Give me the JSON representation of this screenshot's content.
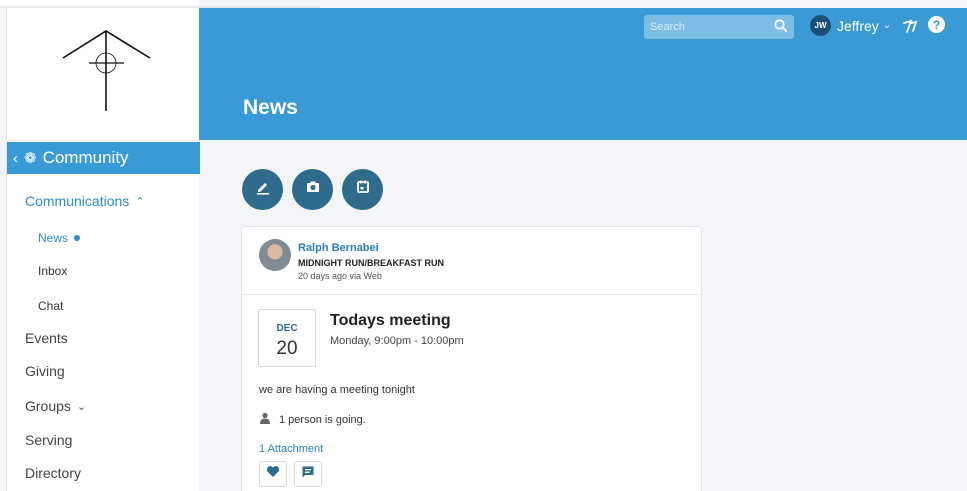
{
  "colors": {
    "accent": "#3a9ad5",
    "action_button": "#2f6b8c",
    "link": "#2c7fbb"
  },
  "sidebar": {
    "community_label": "Community",
    "nav": {
      "communications": "Communications",
      "news": "News",
      "inbox": "Inbox",
      "chat": "Chat",
      "events": "Events",
      "giving": "Giving",
      "groups": "Groups",
      "serving": "Serving",
      "directory": "Directory"
    }
  },
  "header": {
    "title": "News",
    "search_placeholder": "Search",
    "user_initials": "JW",
    "user_name": "Jeffrey",
    "help": "?"
  },
  "actions": [
    {
      "icon": "pencil-icon"
    },
    {
      "icon": "camera-icon"
    },
    {
      "icon": "calendar-icon"
    }
  ],
  "post": {
    "author": "Ralph Bernabei",
    "group": "MIDNIGHT RUN/BREAKFAST RUN",
    "meta": "20 days ago via Web",
    "event": {
      "month": "DEC",
      "day": "20",
      "title": "Todays meeting",
      "time": "Monday, 9:00pm - 10:00pm"
    },
    "body": "we are having a meeting tonight",
    "going": "1 person is going.",
    "attachments": "1 Attachment"
  }
}
